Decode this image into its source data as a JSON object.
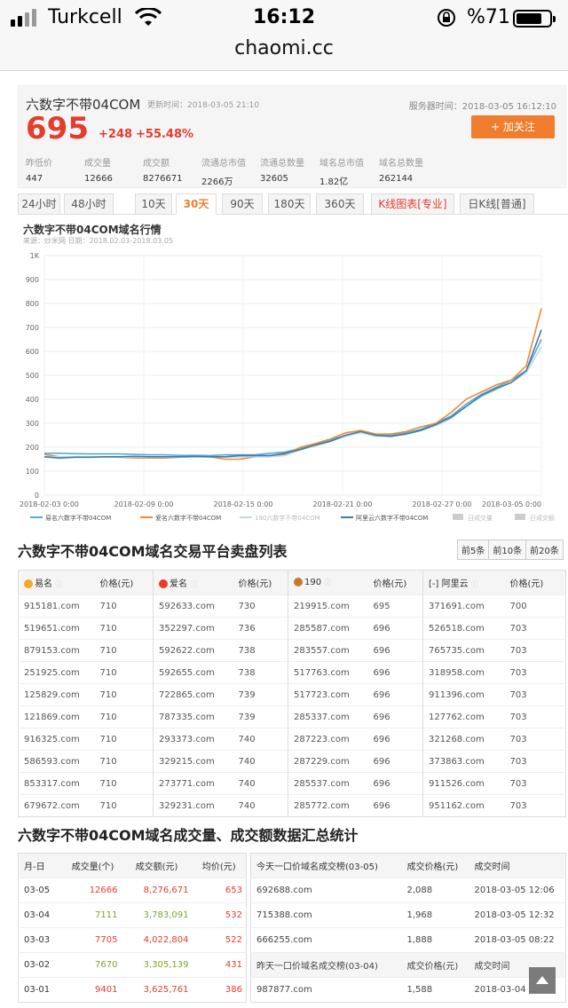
{
  "status": {
    "carrier": "Turkcell",
    "time": "16:12",
    "battery": "%71",
    "url": "chaomi.cc"
  },
  "header": {
    "title": "六数字不带04COM",
    "update_time": "更新时间：2018-03-05 21:10",
    "server_time": "服务器时间：2018-03-05 16:12:10",
    "price": "695",
    "delta": "+248",
    "pct": "+55.48%",
    "follow": "+ 加关注",
    "stats": [
      {
        "label": "昨低价",
        "value": "447"
      },
      {
        "label": "成交量",
        "value": "12666"
      },
      {
        "label": "成交额",
        "value": "8276671"
      },
      {
        "label": "流通总市值",
        "value": "2266万"
      },
      {
        "label": "流通总数量",
        "value": "32605"
      },
      {
        "label": "域名总市值",
        "value": "1.82亿"
      },
      {
        "label": "域名总数量",
        "value": "262144"
      }
    ]
  },
  "tabs": [
    "24小时",
    "48小时",
    "10天",
    "30天",
    "90天",
    "180天",
    "360天",
    "K线图表[专业]",
    "日K线[普通]"
  ],
  "chart_title": "六数字不带04COM域名行情",
  "chart_sub": "来源：炒米网 日期：2018.02.03-2018.03.05",
  "chart_data": {
    "type": "line",
    "title": "六数字不带04COM域名行情",
    "x_ticks": [
      "2018-02-03 0:00",
      "2018-02-09 0:00",
      "2018-02-15 0:00",
      "2018-02-21 0:00",
      "2018-02-27 0:00",
      "2018-03-05 0:00"
    ],
    "y_ticks": [
      "0",
      "100",
      "200",
      "300",
      "400",
      "500",
      "600",
      "700",
      "800",
      "900",
      "1K"
    ],
    "ylim": [
      0,
      1000
    ],
    "legend_position": "bottom",
    "legend": [
      "易名六数字不带04COM",
      "爱名六数字不带04COM",
      "190六数字不带04COM",
      "阿里云六数字不带04COM",
      "日成交量",
      "日成交额"
    ],
    "series": [
      {
        "name": "易名六数字不带04COM",
        "color": "#5aa9e0",
        "values": [
          175,
          175,
          173,
          172,
          172,
          172,
          170,
          168,
          168,
          166,
          166,
          165,
          168,
          168,
          168,
          175,
          180,
          195,
          210,
          230,
          250,
          265,
          250,
          250,
          260,
          275,
          300,
          330,
          380,
          420,
          450,
          480,
          520,
          650
        ]
      },
      {
        "name": "爱名六数字不带04COM",
        "color": "#ef8b35",
        "values": [
          170,
          160,
          160,
          160,
          160,
          158,
          155,
          155,
          155,
          158,
          160,
          160,
          150,
          150,
          160,
          165,
          170,
          200,
          215,
          235,
          260,
          270,
          255,
          255,
          265,
          285,
          300,
          345,
          400,
          430,
          460,
          480,
          540,
          780
        ]
      },
      {
        "name": "190六数字不带04COM",
        "color": "#c8d7e6",
        "values": [
          160,
          160,
          160,
          160,
          160,
          158,
          158,
          158,
          158,
          158,
          160,
          160,
          160,
          160,
          160,
          160,
          165,
          190,
          205,
          225,
          245,
          260,
          245,
          245,
          255,
          270,
          290,
          320,
          370,
          410,
          440,
          470,
          510,
          620
        ]
      },
      {
        "name": "阿里云六数字不带04COM",
        "color": "#3a7fa6",
        "values": [
          160,
          155,
          158,
          158,
          160,
          160,
          162,
          160,
          160,
          160,
          162,
          160,
          160,
          165,
          165,
          165,
          175,
          190,
          210,
          225,
          250,
          265,
          250,
          245,
          255,
          270,
          295,
          325,
          370,
          415,
          445,
          470,
          520,
          690
        ]
      }
    ]
  },
  "list_title": "六数字不带04COM域名交易平台卖盘列表",
  "list_buttons": [
    "前5条",
    "前10条",
    "前20条"
  ],
  "list_headers": [
    {
      "platform": "易名",
      "price": "价格(元)"
    },
    {
      "platform": "爱名",
      "price": "价格(元)"
    },
    {
      "platform": "190",
      "price": "价格(元)"
    },
    {
      "platform": "阿里云",
      "price": "价格(元)"
    }
  ],
  "list_rows": [
    [
      "915181.com",
      "710",
      "592633.com",
      "730",
      "219915.com",
      "695",
      "371691.com",
      "700"
    ],
    [
      "519651.com",
      "710",
      "352297.com",
      "736",
      "285587.com",
      "696",
      "526518.com",
      "703"
    ],
    [
      "879153.com",
      "710",
      "592622.com",
      "738",
      "283557.com",
      "696",
      "765735.com",
      "703"
    ],
    [
      "251925.com",
      "710",
      "592655.com",
      "738",
      "517763.com",
      "696",
      "318958.com",
      "703"
    ],
    [
      "125829.com",
      "710",
      "722865.com",
      "739",
      "517723.com",
      "696",
      "911396.com",
      "703"
    ],
    [
      "121869.com",
      "710",
      "787335.com",
      "739",
      "285337.com",
      "696",
      "127762.com",
      "703"
    ],
    [
      "916325.com",
      "710",
      "293373.com",
      "740",
      "287223.com",
      "696",
      "321268.com",
      "703"
    ],
    [
      "586593.com",
      "710",
      "329215.com",
      "740",
      "287229.com",
      "696",
      "373863.com",
      "703"
    ],
    [
      "853317.com",
      "710",
      "273771.com",
      "740",
      "285537.com",
      "696",
      "911526.com",
      "703"
    ],
    [
      "679672.com",
      "710",
      "329231.com",
      "740",
      "285772.com",
      "696",
      "951162.com",
      "703"
    ]
  ],
  "stats_title": "六数字不带04COM域名成交量、成交额数据汇总统计",
  "daily_headers": [
    "月-日",
    "成交量(个)",
    "成交额(元)",
    "均价(元)"
  ],
  "daily_rows": [
    [
      "03-05",
      "12666",
      "8,276,671",
      "653"
    ],
    [
      "03-04",
      "7111",
      "3,783,091",
      "532"
    ],
    [
      "03-03",
      "7705",
      "4,022,804",
      "522"
    ],
    [
      "03-02",
      "7670",
      "3,305,139",
      "431"
    ],
    [
      "03-01",
      "9401",
      "3,625,761",
      "386"
    ]
  ],
  "top_today_headers": [
    "今天一口价域名成交榜(03-05)",
    "成交价格(元)",
    "成交时间"
  ],
  "top_today_rows": [
    [
      "692688.com",
      "2,088",
      "2018-03-05 12:06"
    ],
    [
      "715388.com",
      "1,968",
      "2018-03-05 12:32"
    ],
    [
      "666255.com",
      "1,888",
      "2018-03-05 08:22"
    ]
  ],
  "top_yday_headers": [
    "昨天一口价域名成交榜(03-04)",
    "成交价格(元)",
    "成交时间"
  ],
  "top_yday_rows": [
    [
      "987877.com",
      "1,588",
      "2018-03-04 ..."
    ]
  ]
}
